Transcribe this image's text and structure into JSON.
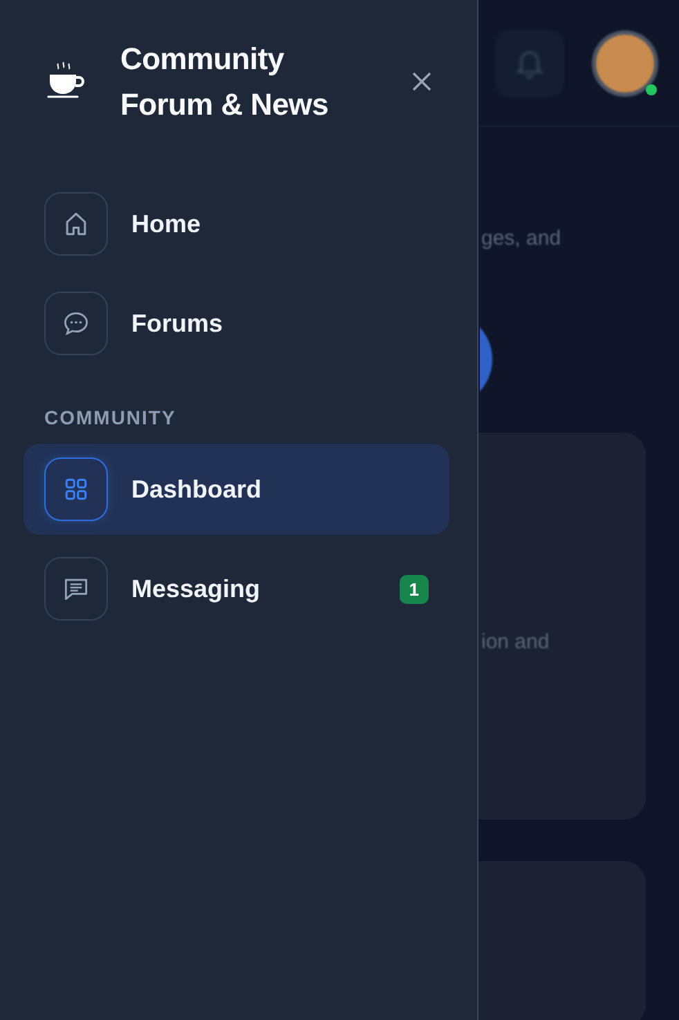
{
  "drawer": {
    "title": "Community Forum & News",
    "items": [
      {
        "label": "Home",
        "kind": "home",
        "selected": false
      },
      {
        "label": "Forums",
        "kind": "chat",
        "selected": false
      }
    ],
    "sections": [
      {
        "heading": "COMMUNITY",
        "items": [
          {
            "label": "Dashboard",
            "kind": "grid",
            "selected": true
          },
          {
            "label": "Messaging",
            "kind": "message",
            "selected": false,
            "badge": "1"
          }
        ]
      }
    ]
  },
  "background": {
    "header": {
      "avatar_online": true
    },
    "texts": [
      "ges, and",
      "ion and"
    ]
  }
}
